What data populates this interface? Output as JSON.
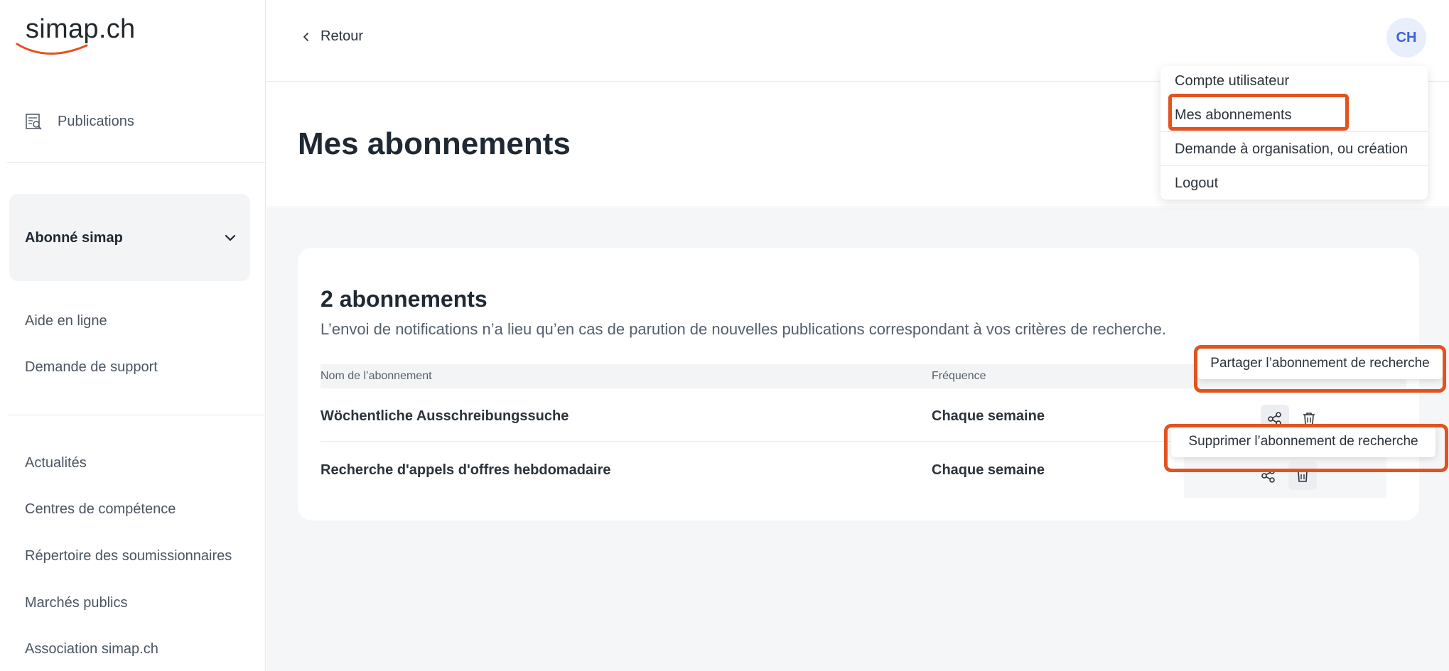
{
  "sidebar": {
    "logo": "simap.ch",
    "publications": "Publications",
    "group_label": "Abonné simap",
    "help": "Aide en ligne",
    "support": "Demande de support",
    "links": [
      "Actualités",
      "Centres de compétence",
      "Répertoire des soumissionnaires",
      "Marchés publics",
      "Association simap.ch"
    ]
  },
  "topbar": {
    "back": "Retour",
    "avatar": "CH"
  },
  "page": {
    "title": "Mes abonnements"
  },
  "user_menu": {
    "items": [
      "Compte utilisateur",
      "Mes abonnements",
      "Demande à organisation, ou création",
      "Logout"
    ]
  },
  "subscriptions": {
    "count_title": "2 abonnements",
    "subtitle": "L’envoi de notifications n’a lieu qu’en cas de parution de nouvelles publications correspondant à vos critères de recherche.",
    "col_name": "Nom de l’abonnement",
    "col_freq": "Fréquence",
    "rows": [
      {
        "name": "Wöchentliche Ausschreibungssuche",
        "frequency": "Chaque semaine"
      },
      {
        "name": "Recherche d'appels d'offres hebdomadaire",
        "frequency": "Chaque semaine"
      }
    ]
  },
  "tooltips": {
    "share": "Partager l’abonnement de recherche",
    "delete": "Supprimer l’abonnement de recherche"
  },
  "icons": {
    "publications": "publications-search-icon",
    "chevron": "chevron-down-icon",
    "back": "chevron-left-icon",
    "share": "share-icon",
    "delete": "trash-icon"
  },
  "colors": {
    "highlight": "#e2531f",
    "logo_swoosh": "#e2531f",
    "avatar_text": "#3d63d8"
  }
}
